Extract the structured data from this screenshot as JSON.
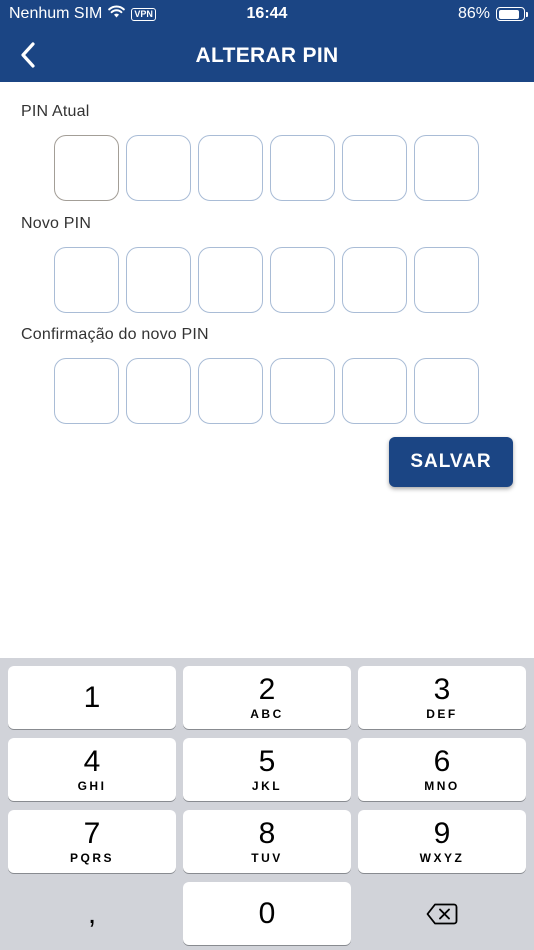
{
  "status_bar": {
    "carrier": "Nenhum SIM",
    "vpn": "VPN",
    "time": "16:44",
    "battery": "86%",
    "battery_level": 0.86
  },
  "header": {
    "title": "ALTERAR PIN"
  },
  "form": {
    "current_pin_label": "PIN Atual",
    "new_pin_label": "Novo PIN",
    "confirm_pin_label": "Confirmação do novo PIN",
    "pin_length": 6,
    "save_label": "SALVAR"
  },
  "keyboard": {
    "keys": [
      {
        "num": "1",
        "letters": ""
      },
      {
        "num": "2",
        "letters": "ABC"
      },
      {
        "num": "3",
        "letters": "DEF"
      },
      {
        "num": "4",
        "letters": "GHI"
      },
      {
        "num": "5",
        "letters": "JKL"
      },
      {
        "num": "6",
        "letters": "MNO"
      },
      {
        "num": "7",
        "letters": "PQRS"
      },
      {
        "num": "8",
        "letters": "TUV"
      },
      {
        "num": "9",
        "letters": "WXYZ"
      },
      {
        "num": ",",
        "letters": ""
      },
      {
        "num": "0",
        "letters": ""
      }
    ]
  },
  "colors": {
    "brand": "#1b4584",
    "pin_border": "#a9bcd6",
    "keyboard_bg": "#d1d3d9"
  }
}
